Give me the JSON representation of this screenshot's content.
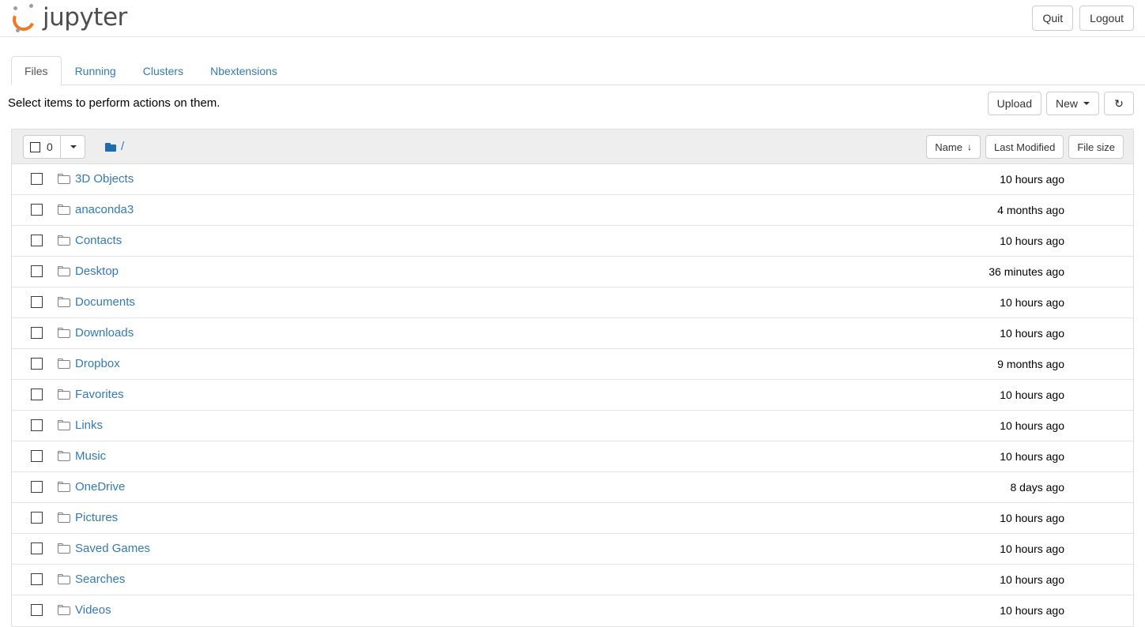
{
  "header": {
    "brand_text": "jupyter",
    "logo_icon": "jupyter-logo-icon",
    "accent_color": "#f37726",
    "buttons": [
      {
        "label": "Quit",
        "name": "quit-button"
      },
      {
        "label": "Logout",
        "name": "logout-button"
      }
    ]
  },
  "tabs": [
    {
      "label": "Files",
      "active": true
    },
    {
      "label": "Running",
      "active": false
    },
    {
      "label": "Clusters",
      "active": false
    },
    {
      "label": "Nbextensions",
      "active": false
    }
  ],
  "action_bar": {
    "message": "Select items to perform actions on them.",
    "upload_label": "Upload",
    "new_label": "New",
    "new_caret_icon": "chevron-down-icon",
    "refresh_icon": "refresh-icon",
    "refresh_glyph": "↻"
  },
  "list_toolbar": {
    "select_all_checkbox_icon": "checkbox-icon",
    "selected_count": "0",
    "select_dropdown_icon": "chevron-down-icon",
    "breadcrumb_folder_icon": "folder-icon",
    "breadcrumb_path": "/",
    "sort_buttons": [
      {
        "label": "Name",
        "name": "sort-by-name-button",
        "arrow": "↓",
        "active": true
      },
      {
        "label": "Last Modified",
        "name": "sort-by-last-modified-button",
        "arrow": "",
        "active": false
      },
      {
        "label": "File size",
        "name": "sort-by-file-size-button",
        "arrow": "",
        "active": false
      }
    ]
  },
  "files": [
    {
      "name": "3D Objects",
      "icon": "folder-icon",
      "modified": "10 hours ago",
      "size": ""
    },
    {
      "name": "anaconda3",
      "icon": "folder-icon",
      "modified": "4 months ago",
      "size": ""
    },
    {
      "name": "Contacts",
      "icon": "folder-icon",
      "modified": "10 hours ago",
      "size": ""
    },
    {
      "name": "Desktop",
      "icon": "folder-icon",
      "modified": "36 minutes ago",
      "size": ""
    },
    {
      "name": "Documents",
      "icon": "folder-icon",
      "modified": "10 hours ago",
      "size": ""
    },
    {
      "name": "Downloads",
      "icon": "folder-icon",
      "modified": "10 hours ago",
      "size": ""
    },
    {
      "name": "Dropbox",
      "icon": "folder-icon",
      "modified": "9 months ago",
      "size": ""
    },
    {
      "name": "Favorites",
      "icon": "folder-icon",
      "modified": "10 hours ago",
      "size": ""
    },
    {
      "name": "Links",
      "icon": "folder-icon",
      "modified": "10 hours ago",
      "size": ""
    },
    {
      "name": "Music",
      "icon": "folder-icon",
      "modified": "10 hours ago",
      "size": ""
    },
    {
      "name": "OneDrive",
      "icon": "folder-icon",
      "modified": "8 days ago",
      "size": ""
    },
    {
      "name": "Pictures",
      "icon": "folder-icon",
      "modified": "10 hours ago",
      "size": ""
    },
    {
      "name": "Saved Games",
      "icon": "folder-icon",
      "modified": "10 hours ago",
      "size": ""
    },
    {
      "name": "Searches",
      "icon": "folder-icon",
      "modified": "10 hours ago",
      "size": ""
    },
    {
      "name": "Videos",
      "icon": "folder-icon",
      "modified": "10 hours ago",
      "size": ""
    }
  ]
}
